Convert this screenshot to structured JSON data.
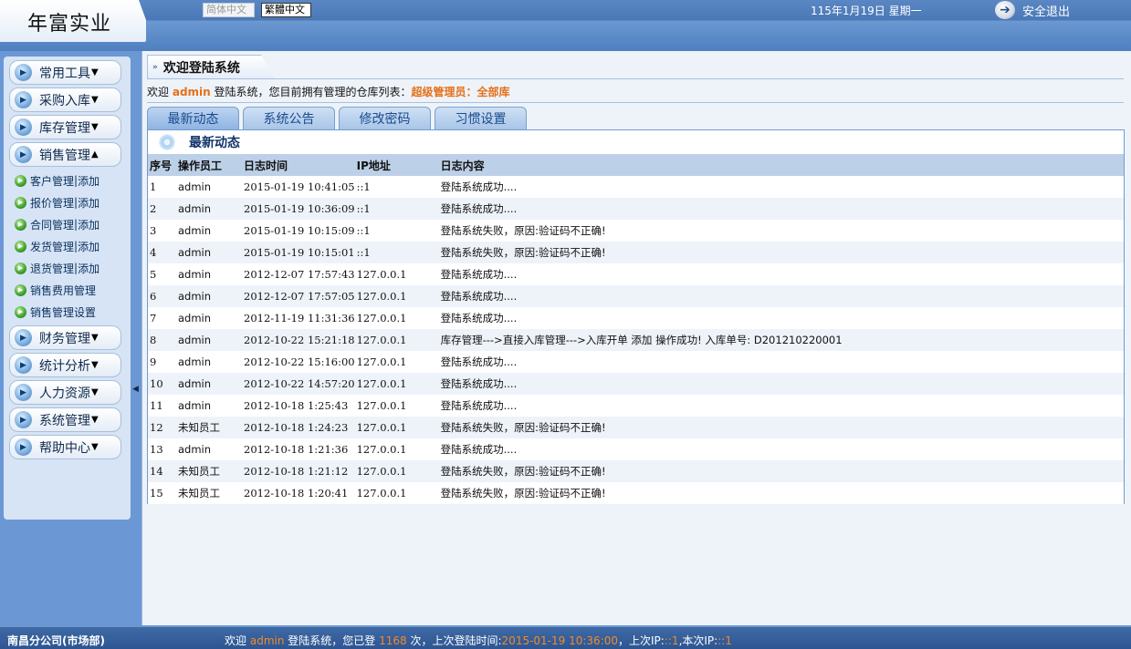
{
  "header": {
    "logo": "年富实业",
    "lang_simplified": "简体中文",
    "lang_traditional": "繁體中文",
    "date": "115年1月19日 星期一",
    "logout": "安全退出"
  },
  "sidebar": {
    "menus_top": [
      {
        "label": "常用工具",
        "caret": "▼"
      },
      {
        "label": "采购入库",
        "caret": "▼"
      },
      {
        "label": "库存管理",
        "caret": "▼"
      },
      {
        "label": "销售管理",
        "caret": "▲"
      }
    ],
    "sub_items": [
      {
        "label": "客户管理",
        "add": "添加"
      },
      {
        "label": "报价管理",
        "add": "添加"
      },
      {
        "label": "合同管理",
        "add": "添加"
      },
      {
        "label": "发货管理",
        "add": "添加"
      },
      {
        "label": "退货管理",
        "add": "添加"
      },
      {
        "label": "销售费用管理",
        "add": ""
      },
      {
        "label": "销售管理设置",
        "add": ""
      }
    ],
    "menus_bottom": [
      {
        "label": "财务管理",
        "caret": "▼"
      },
      {
        "label": "统计分析",
        "caret": "▼"
      },
      {
        "label": "人力资源",
        "caret": "▼"
      },
      {
        "label": "系统管理",
        "caret": "▼"
      },
      {
        "label": "帮助中心",
        "caret": "▼"
      }
    ]
  },
  "main": {
    "title": "欢迎登陆系统",
    "welcome_prefix": "欢迎",
    "welcome_user": "admin",
    "welcome_middle": "登陆系统，您目前拥有管理的仓库列表：",
    "welcome_role": "超级管理员：全部库",
    "tabs": [
      "最新动态",
      "系统公告",
      "修改密码",
      "习惯设置"
    ],
    "panel_title": "最新动态",
    "columns": [
      "序号",
      "操作员工",
      "日志时间",
      "IP地址",
      "日志内容"
    ],
    "rows": [
      [
        "1",
        "admin",
        "2015-01-19 10:41:05",
        "::1",
        "登陆系统成功...."
      ],
      [
        "2",
        "admin",
        "2015-01-19 10:36:09",
        "::1",
        "登陆系统成功...."
      ],
      [
        "3",
        "admin",
        "2015-01-19 10:15:09",
        "::1",
        "登陆系统失败，原因:验证码不正确!"
      ],
      [
        "4",
        "admin",
        "2015-01-19 10:15:01",
        "::1",
        "登陆系统失败，原因:验证码不正确!"
      ],
      [
        "5",
        "admin",
        "2012-12-07 17:57:43",
        "127.0.0.1",
        "登陆系统成功...."
      ],
      [
        "6",
        "admin",
        "2012-12-07 17:57:05",
        "127.0.0.1",
        "登陆系统成功...."
      ],
      [
        "7",
        "admin",
        "2012-11-19 11:31:36",
        "127.0.0.1",
        "登陆系统成功...."
      ],
      [
        "8",
        "admin",
        "2012-10-22 15:21:18",
        "127.0.0.1",
        "库存管理--->直接入库管理--->入库开单 添加 操作成功! 入库单号: D201210220001"
      ],
      [
        "9",
        "admin",
        "2012-10-22 15:16:00",
        "127.0.0.1",
        "登陆系统成功...."
      ],
      [
        "10",
        "admin",
        "2012-10-22 14:57:20",
        "127.0.0.1",
        "登陆系统成功...."
      ],
      [
        "11",
        "admin",
        "2012-10-18 1:25:43",
        "127.0.0.1",
        "登陆系统成功...."
      ],
      [
        "12",
        "未知员工",
        "2012-10-18 1:24:23",
        "127.0.0.1",
        "登陆系统失败，原因:验证码不正确!"
      ],
      [
        "13",
        "admin",
        "2012-10-18 1:21:36",
        "127.0.0.1",
        "登陆系统成功...."
      ],
      [
        "14",
        "未知员工",
        "2012-10-18 1:21:12",
        "127.0.0.1",
        "登陆系统失败，原因:验证码不正确!"
      ],
      [
        "15",
        "未知员工",
        "2012-10-18 1:20:41",
        "127.0.0.1",
        "登陆系统失败，原因:验证码不正确!"
      ]
    ]
  },
  "footer": {
    "branch": "南昌分公司(市场部)",
    "msg_1": "欢迎",
    "user": "admin",
    "msg_2": "登陆系统，您已登",
    "count": "1168",
    "msg_3": "次，上次登陆时间:",
    "last_time": "2015-01-19 10:36:00",
    "msg_4": "，上次IP:",
    "last_ip": "::1",
    "msg_5": ",本次IP:",
    "this_ip": "::1"
  },
  "colors": {
    "accent_orange": "#e57018",
    "header_blue": "#4a78b6",
    "footer_blue": "#2d5591"
  }
}
